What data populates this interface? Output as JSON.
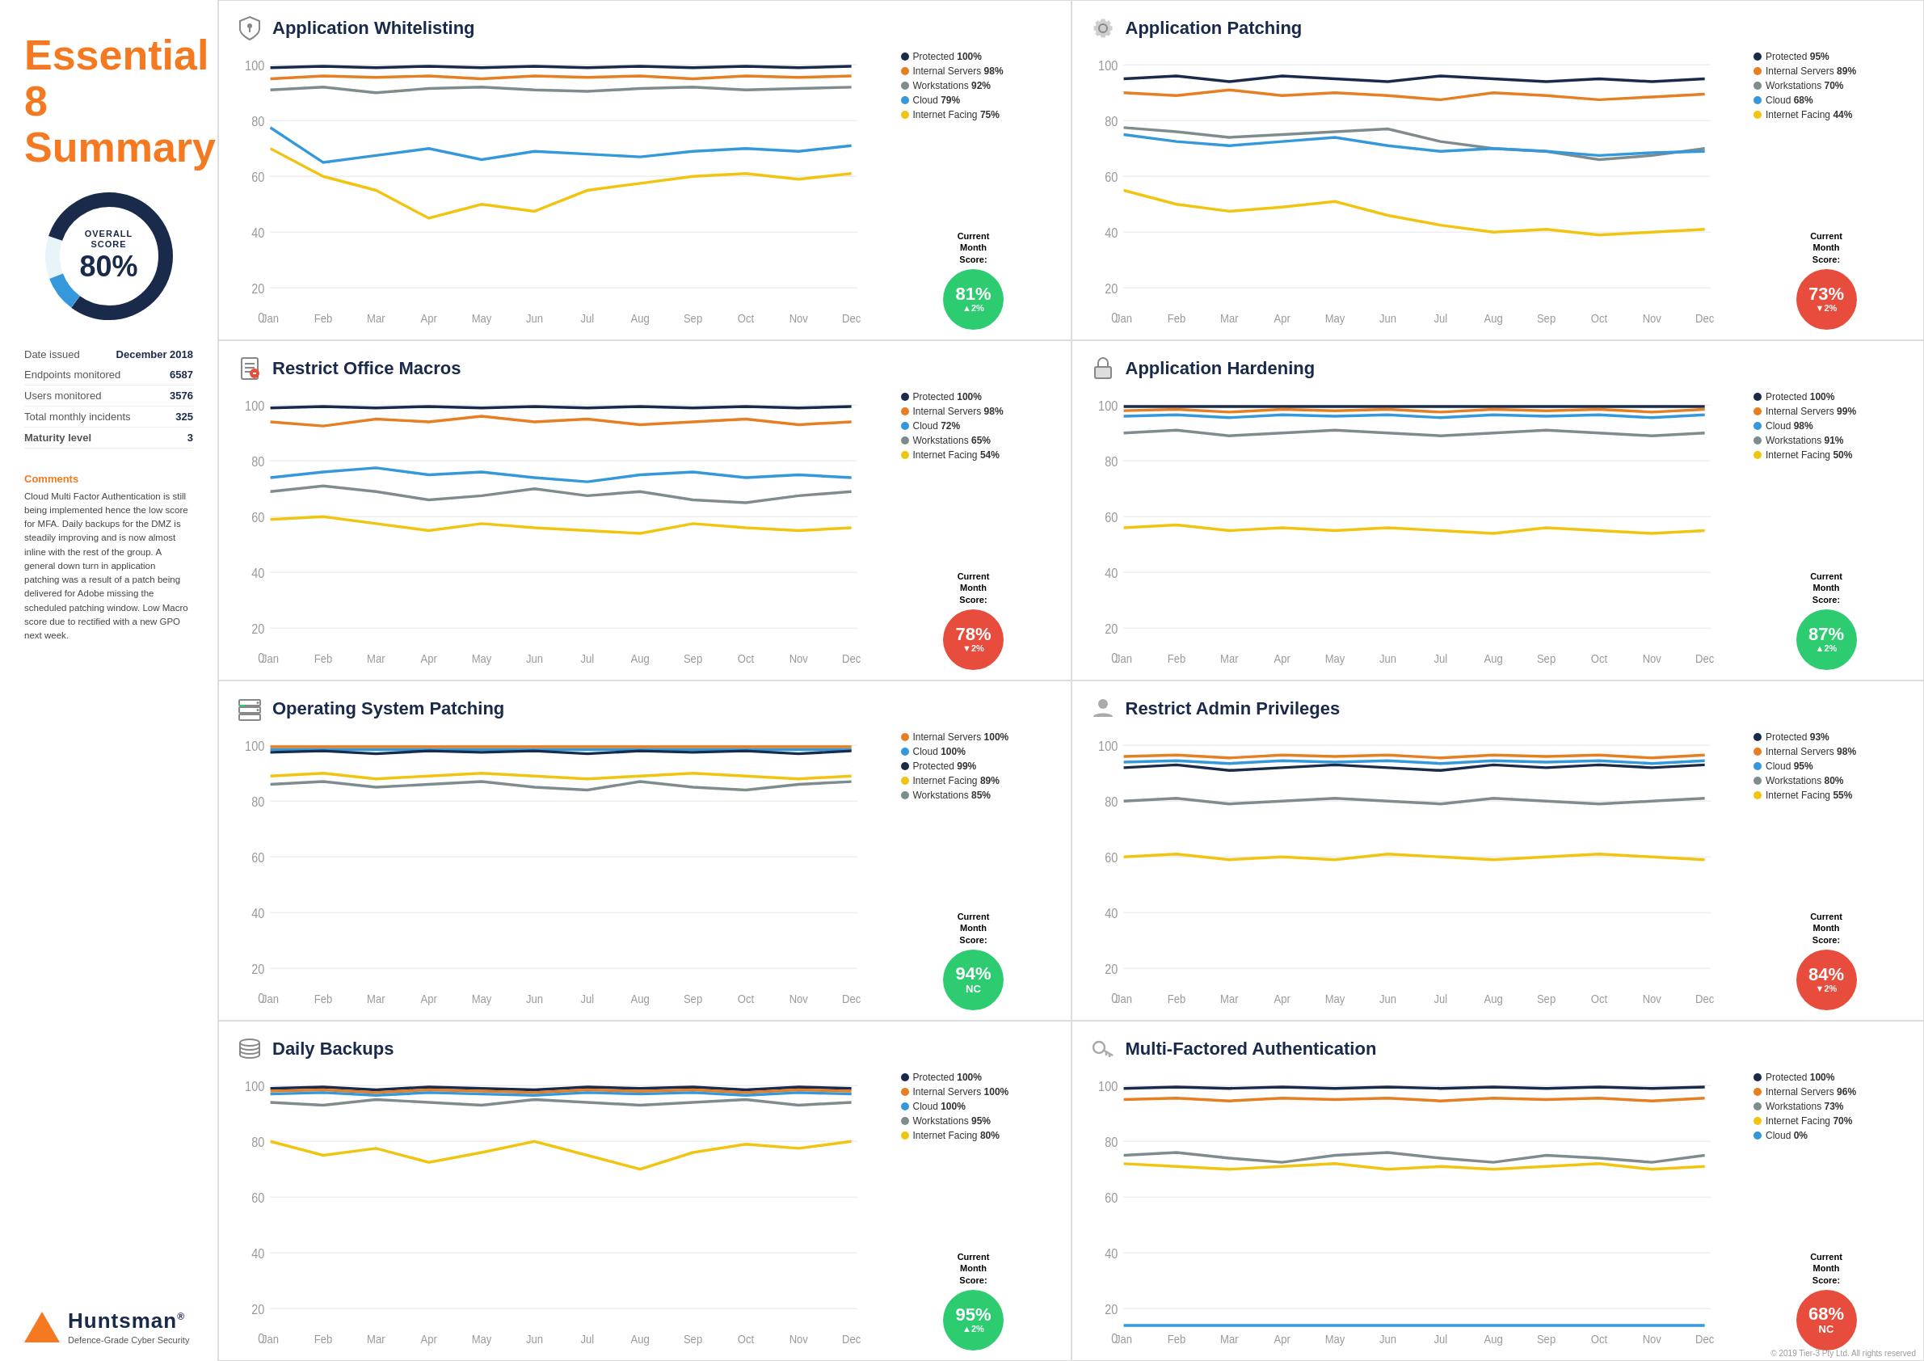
{
  "sidebar": {
    "title": "Essential 8\nSummary",
    "overall_label": "OVERALL\nSCORE",
    "overall_score": "80%",
    "donut_value": 80,
    "date_label": "Date issued",
    "date_value": "December 2018",
    "endpoints_label": "Endpoints monitored",
    "endpoints_value": "6587",
    "users_label": "Users monitored",
    "users_value": "3576",
    "incidents_label": "Total monthly incidents",
    "incidents_value": "325",
    "maturity_label": "Maturity level",
    "maturity_value": "3",
    "comments_title": "Comments",
    "comments_text": "Cloud Multi Factor Authentication is still being implemented hence the low score for MFA. Daily backups for the DMZ is steadily improving and is now almost inline with the rest of the group. A general down turn in application patching was a result of a patch being delivered for Adobe missing the scheduled patching window. Low Macro score due to rectified with a new GPO next week.",
    "logo_brand": "Huntsman",
    "logo_tagline": "Defence-Grade Cyber Security"
  },
  "panels": [
    {
      "id": "app-whitelisting",
      "title": "Application Whitelisting",
      "icon": "shield",
      "legend": [
        {
          "label": "Protected",
          "value": "100%",
          "color": "#1a2a4a"
        },
        {
          "label": "Internal Servers",
          "value": "98%",
          "color": "#e67e22"
        },
        {
          "label": "Workstations",
          "value": "92%",
          "color": "#7f8c8d"
        },
        {
          "label": "Cloud",
          "value": "79%",
          "color": "#3498db"
        },
        {
          "label": "Internet Facing",
          "value": "75%",
          "color": "#f1c40f"
        }
      ],
      "score": "81%",
      "score_change": "▲2%",
      "score_color": "green"
    },
    {
      "id": "app-patching",
      "title": "Application Patching",
      "icon": "gear",
      "legend": [
        {
          "label": "Protected",
          "value": "95%",
          "color": "#1a2a4a"
        },
        {
          "label": "Internal Servers",
          "value": "89%",
          "color": "#e67e22"
        },
        {
          "label": "Workstations",
          "value": "70%",
          "color": "#7f8c8d"
        },
        {
          "label": "Cloud",
          "value": "68%",
          "color": "#3498db"
        },
        {
          "label": "Internet Facing",
          "value": "44%",
          "color": "#f1c40f"
        }
      ],
      "score": "73%",
      "score_change": "▼2%",
      "score_color": "red"
    },
    {
      "id": "restrict-macros",
      "title": "Restrict Office Macros",
      "icon": "document",
      "legend": [
        {
          "label": "Protected",
          "value": "100%",
          "color": "#1a2a4a"
        },
        {
          "label": "Internal Servers",
          "value": "98%",
          "color": "#e67e22"
        },
        {
          "label": "Cloud",
          "value": "72%",
          "color": "#3498db"
        },
        {
          "label": "Workstations",
          "value": "65%",
          "color": "#7f8c8d"
        },
        {
          "label": "Internet Facing",
          "value": "54%",
          "color": "#f1c40f"
        }
      ],
      "score": "78%",
      "score_change": "▼2%",
      "score_color": "red"
    },
    {
      "id": "app-hardening",
      "title": "Application Hardening",
      "icon": "lock",
      "legend": [
        {
          "label": "Protected",
          "value": "100%",
          "color": "#1a2a4a"
        },
        {
          "label": "Internal Servers",
          "value": "99%",
          "color": "#e67e22"
        },
        {
          "label": "Cloud",
          "value": "98%",
          "color": "#3498db"
        },
        {
          "label": "Workstations",
          "value": "91%",
          "color": "#7f8c8d"
        },
        {
          "label": "Internet Facing",
          "value": "50%",
          "color": "#f1c40f"
        }
      ],
      "score": "87%",
      "score_change": "▲2%",
      "score_color": "green"
    },
    {
      "id": "os-patching",
      "title": "Operating System Patching",
      "icon": "server",
      "legend": [
        {
          "label": "Internal Servers",
          "value": "100%",
          "color": "#e67e22"
        },
        {
          "label": "Cloud",
          "value": "100%",
          "color": "#3498db"
        },
        {
          "label": "Protected",
          "value": "99%",
          "color": "#1a2a4a"
        },
        {
          "label": "Internet Facing",
          "value": "89%",
          "color": "#f1c40f"
        },
        {
          "label": "Workstations",
          "value": "85%",
          "color": "#7f8c8d"
        }
      ],
      "score": "94%",
      "score_change": "NC",
      "score_color": "green"
    },
    {
      "id": "restrict-admin",
      "title": "Restrict Admin Privileges",
      "icon": "user",
      "legend": [
        {
          "label": "Protected",
          "value": "93%",
          "color": "#1a2a4a"
        },
        {
          "label": "Internal Servers",
          "value": "98%",
          "color": "#e67e22"
        },
        {
          "label": "Cloud",
          "value": "95%",
          "color": "#3498db"
        },
        {
          "label": "Workstations",
          "value": "80%",
          "color": "#7f8c8d"
        },
        {
          "label": "Internet Facing",
          "value": "55%",
          "color": "#f1c40f"
        }
      ],
      "score": "84%",
      "score_change": "▼2%",
      "score_color": "red"
    },
    {
      "id": "daily-backups",
      "title": "Daily Backups",
      "icon": "stack",
      "legend": [
        {
          "label": "Protected",
          "value": "100%",
          "color": "#1a2a4a"
        },
        {
          "label": "Internal Servers",
          "value": "100%",
          "color": "#e67e22"
        },
        {
          "label": "Cloud",
          "value": "100%",
          "color": "#3498db"
        },
        {
          "label": "Workstations",
          "value": "95%",
          "color": "#7f8c8d"
        },
        {
          "label": "Internet Facing",
          "value": "80%",
          "color": "#f1c40f"
        }
      ],
      "score": "95%",
      "score_change": "▲2%",
      "score_color": "green"
    },
    {
      "id": "mfa",
      "title": "Multi-Factored Authentication",
      "icon": "key",
      "legend": [
        {
          "label": "Protected",
          "value": "100%",
          "color": "#1a2a4a"
        },
        {
          "label": "Internal Servers",
          "value": "96%",
          "color": "#e67e22"
        },
        {
          "label": "Workstations",
          "value": "73%",
          "color": "#7f8c8d"
        },
        {
          "label": "Internet Facing",
          "value": "70%",
          "color": "#f1c40f"
        },
        {
          "label": "Cloud",
          "value": "0%",
          "color": "#3498db"
        }
      ],
      "score": "68%",
      "score_change": "NC",
      "score_color": "red"
    }
  ],
  "chart": {
    "x_labels": [
      "Jan",
      "Feb",
      "Mar",
      "Apr",
      "May",
      "Jun",
      "Jul",
      "Aug",
      "Sep",
      "Oct",
      "Nov",
      "Dec"
    ],
    "y_labels": [
      "0",
      "20",
      "40",
      "60",
      "80",
      "100"
    ],
    "current_month_label": "Current Month",
    "score_label": "Score:"
  },
  "footer": {
    "copyright": "© 2019 Tier-3 Pty Ltd. All rights reserved"
  }
}
